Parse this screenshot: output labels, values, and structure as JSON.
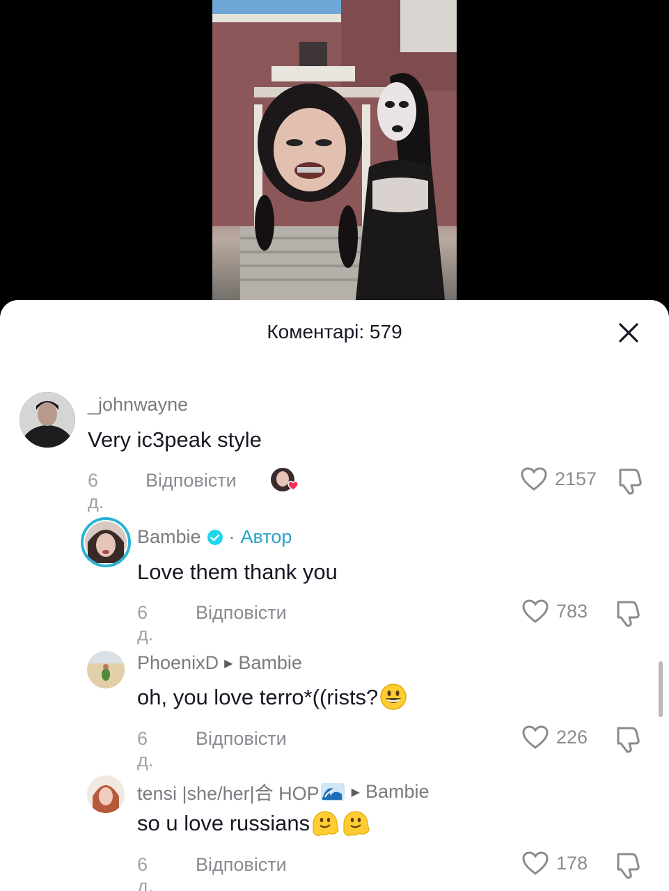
{
  "header": {
    "title": "Коментарі: 579"
  },
  "icons": {
    "close": "close-icon",
    "heart": "heart-icon",
    "dislike": "thumbs-down-icon",
    "verified": "verified-badge-icon"
  },
  "colors": {
    "author": "#2aa3c8",
    "like_heart_reaction": "#fe2c55",
    "text": "#161823",
    "meta": "#8a8b91"
  },
  "comments": [
    {
      "username": "_johnwayne",
      "text": "Very ic3peak style",
      "time": "6 д.",
      "reply_label": "Відповісти",
      "likes": "2157",
      "creator_liked": true
    },
    {
      "username": "Bambie",
      "verified": true,
      "separator": "·",
      "author_label": "Автор",
      "text": "Love them thank you",
      "time": "6 д.",
      "reply_label": "Відповісти",
      "likes": "783"
    },
    {
      "username": "PhoenixD",
      "reply_to": "Bambie",
      "text": "oh, you love terro*((rists?",
      "emoji": "grinning-face",
      "time": "6 д.",
      "reply_label": "Відповісти",
      "likes": "226"
    },
    {
      "username": "tensi |she/her|合 HOP",
      "username_emoji": "wave",
      "reply_to": "Bambie",
      "text": "so u love russians",
      "emoji": "melting-face x2",
      "time": "6 д.",
      "reply_label": "Відповісти",
      "likes": "178"
    }
  ]
}
